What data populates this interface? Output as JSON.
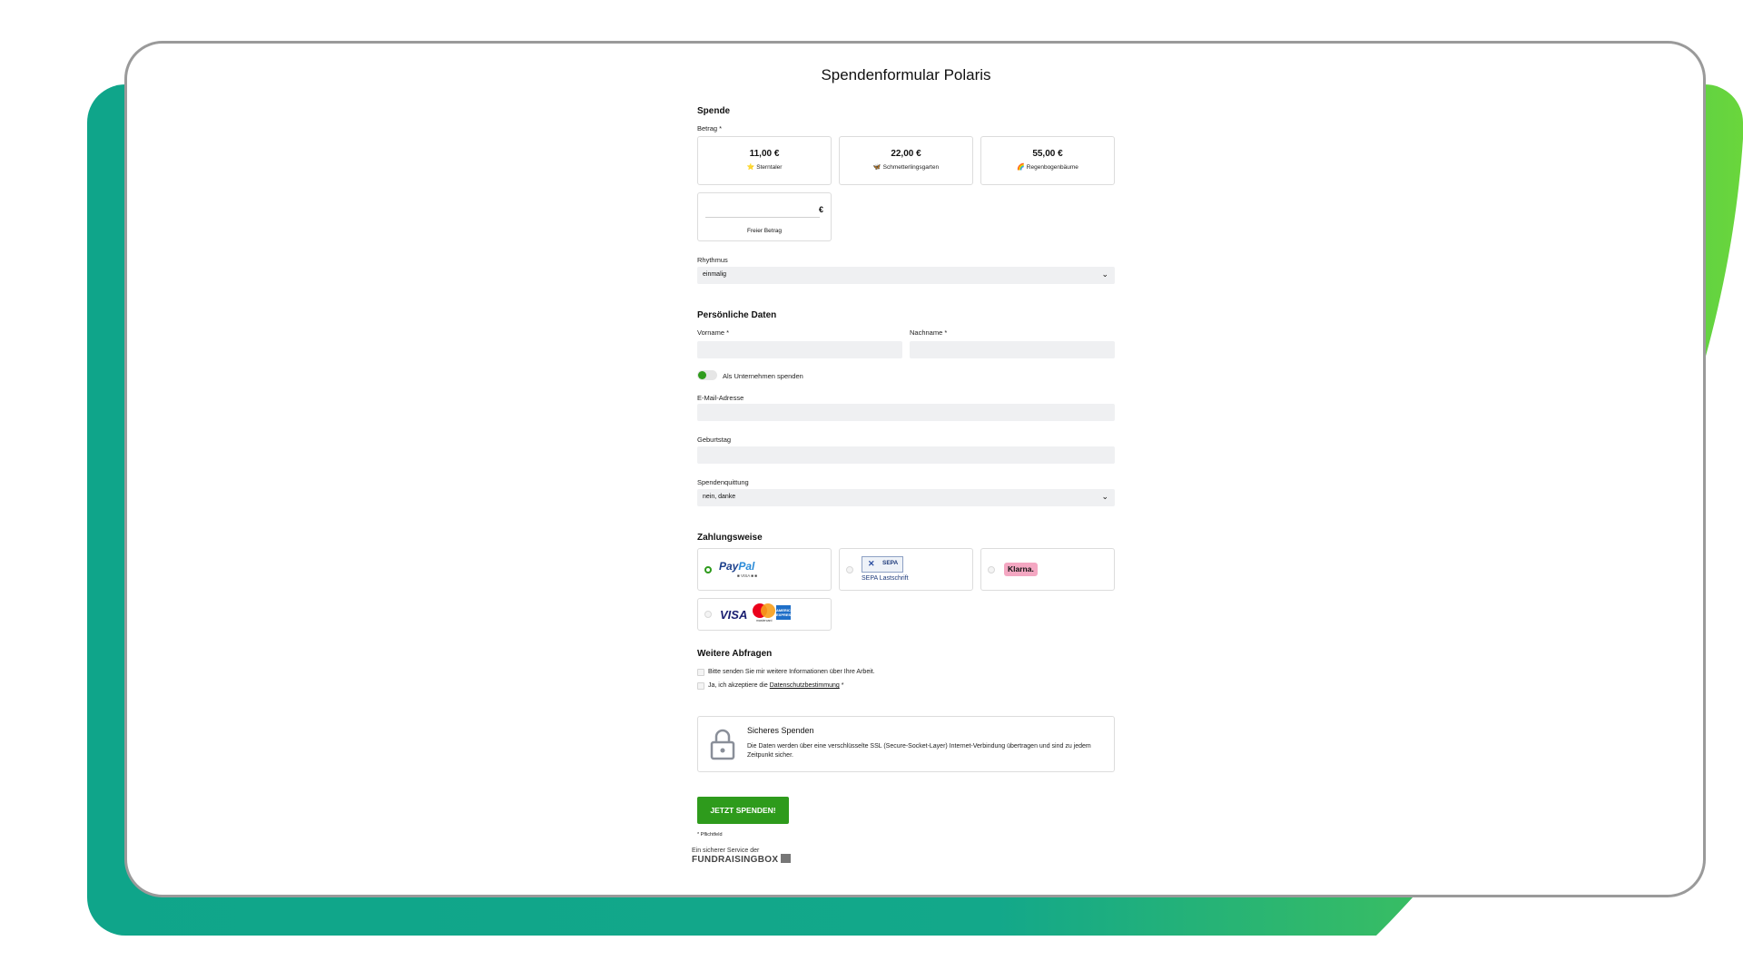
{
  "title": "Spendenformular Polaris",
  "sections": {
    "donation": "Spende",
    "personal": "Persönliche Daten",
    "payment": "Zahlungsweise",
    "more": "Weitere Abfragen"
  },
  "donation": {
    "amount_label": "Betrag *",
    "options": [
      {
        "value": "11,00 €",
        "name": "Sterntaler",
        "icon": "⭐",
        "icon_name": "star-icon"
      },
      {
        "value": "22,00 €",
        "name": "Schmetterlingsgarten",
        "icon": "🦋",
        "icon_name": "butterfly-icon"
      },
      {
        "value": "55,00 €",
        "name": "Regenbogenbäume",
        "icon": "🌈",
        "icon_name": "rainbow-icon"
      }
    ],
    "free_currency": "€",
    "free_label": "Freier Betrag",
    "rhythm_label": "Rhythmus",
    "rhythm_value": "einmalig"
  },
  "personal": {
    "firstname_label": "Vorname *",
    "lastname_label": "Nachname *",
    "company_toggle_label": "Als Unternehmen spenden",
    "email_label": "E-Mail-Adresse",
    "birthday_label": "Geburtstag",
    "receipt_label": "Spendenquittung",
    "receipt_value": "nein, danke"
  },
  "payment": {
    "paypal_a": "Pay",
    "paypal_b": "Pal",
    "paypal_sub": "■ VISA ■ ■",
    "sepa_logo": "SEPA",
    "sepa_label": "SEPA Lastschrift",
    "klarna": "Klarna.",
    "visa": "VISA",
    "mastercard_text": "mastercard",
    "amex": "AMERICAN EXPRESS",
    "selected": "paypal"
  },
  "more": {
    "info_label": "Bitte senden Sie mir weitere Informationen über Ihre Arbeit.",
    "privacy_prefix": "Ja, ich akzeptiere die",
    "privacy_link": "Datenschutzbestimmung",
    "privacy_suffix": "*"
  },
  "secure": {
    "title": "Sicheres Spenden",
    "text": "Die Daten werden über eine verschlüsselte SSL (Secure-Socket-Layer) Internet-Verbindung übertragen und sind zu jedem Zeitpunkt sicher."
  },
  "submit_label": "JETZT SPENDEN!",
  "required_hint": "* Pflichtfeld",
  "brand": {
    "line1": "Ein sicherer Service der",
    "line2": "FUNDRAISINGBOX"
  },
  "colors": {
    "accent": "#2e9b1c",
    "background_gradient_start": "#0fa58a",
    "background_gradient_end": "#6ad63c"
  }
}
